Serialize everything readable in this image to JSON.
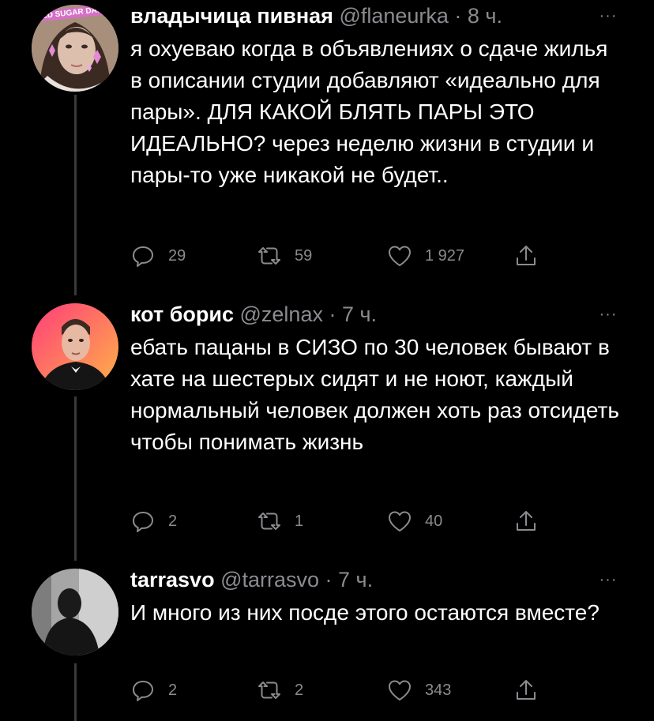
{
  "tweets": [
    {
      "author_name": "владычица пивная",
      "meta": "@flaneurka · 8 ч.",
      "more_label": "···",
      "avatar_text": "ED SUGAR DAD",
      "text": "я охуеваю когда в объявлениях о сдаче жилья в описании студии добавляют «идеально для пары». ДЛЯ КАКОЙ БЛЯТЬ ПАРЫ ЭТО ИДЕАЛЬНО? через неделю жизни в студии и пары-то уже никакой не будет..",
      "replies": "29",
      "retweets": "59",
      "likes": "1 927",
      "avatar_icon": "user-photo"
    },
    {
      "author_name": "кот борис",
      "meta": "@zelnax · 7 ч.",
      "more_label": "···",
      "text": "ебать пацаны в СИЗО по 30 человек бывают в хате на шестерых сидят и не ноют, каждый нормальный человек должен хоть раз отсидеть чтобы понимать жизнь",
      "replies": "2",
      "retweets": "1",
      "likes": "40",
      "avatar_icon": "user-photo"
    },
    {
      "author_name": "tarrasvo",
      "meta": "@tarrasvo · 7 ч.",
      "more_label": "···",
      "text": "И много из них посде этого остаются вместе?",
      "replies": "2",
      "retweets": "2",
      "likes": "343",
      "avatar_icon": "user-photo"
    }
  ],
  "colors": {
    "background": "#000000",
    "text": "#ffffff",
    "secondary": "#8b8b90",
    "thread_line": "#3a3a3c"
  }
}
